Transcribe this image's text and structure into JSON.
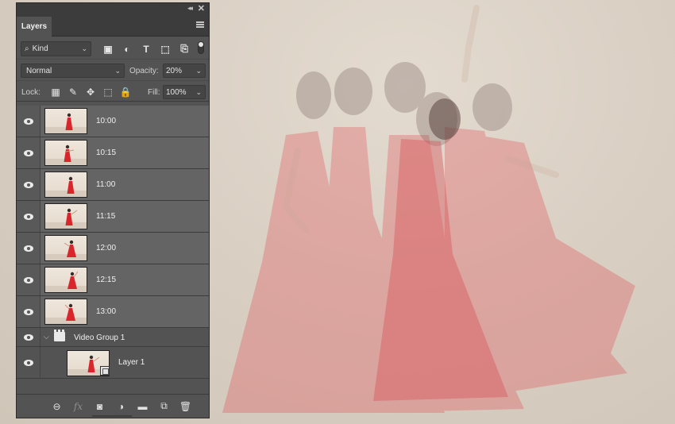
{
  "panel": {
    "collapse_glyph": "◂◂",
    "close_glyph": "✕",
    "tab_label": "Layers",
    "menu_icon": "panel-menu-icon"
  },
  "filter": {
    "kind_label": "Kind",
    "search_glyph": "⌕",
    "chevron": "⌄",
    "icons": [
      {
        "name": "pixel-filter-icon",
        "glyph": "▣"
      },
      {
        "name": "adjustment-filter-icon",
        "glyph": "◐"
      },
      {
        "name": "type-filter-icon",
        "glyph": "T"
      },
      {
        "name": "shape-filter-icon",
        "glyph": "⬚"
      },
      {
        "name": "smart-object-filter-icon",
        "glyph": "⎘"
      }
    ]
  },
  "blend": {
    "mode": "Normal",
    "opacity_label": "Opacity:",
    "opacity_value": "20%",
    "chevron": "⌄"
  },
  "lock": {
    "label": "Lock:",
    "icons": [
      {
        "name": "lock-transparent-icon",
        "glyph": "▦"
      },
      {
        "name": "lock-image-icon",
        "glyph": "✎"
      },
      {
        "name": "lock-position-icon",
        "glyph": "✥"
      },
      {
        "name": "artboard-lock-icon",
        "glyph": "⬚"
      },
      {
        "name": "lock-all-icon",
        "glyph": "🔒"
      }
    ],
    "fill_label": "Fill:",
    "fill_value": "100%"
  },
  "layers": [
    {
      "name": "10:00",
      "pose": 0
    },
    {
      "name": "10:15",
      "pose": 1
    },
    {
      "name": "11:00",
      "pose": 2
    },
    {
      "name": "11:15",
      "pose": 3
    },
    {
      "name": "12:00",
      "pose": 4
    },
    {
      "name": "12:15",
      "pose": 5
    },
    {
      "name": "13:00",
      "pose": 6
    }
  ],
  "group": {
    "disclosure": "⌵",
    "name": "Video Group 1",
    "child": {
      "name": "Layer 1"
    }
  },
  "bottom": {
    "icons": [
      {
        "name": "link-layers-icon",
        "glyph": "⊖"
      },
      {
        "name": "fx-icon",
        "glyph": "fx"
      },
      {
        "name": "add-mask-icon",
        "glyph": "◙"
      },
      {
        "name": "new-adjustment-icon",
        "glyph": "◑"
      },
      {
        "name": "new-group-icon",
        "glyph": "▬"
      },
      {
        "name": "new-layer-icon",
        "glyph": "⧉"
      },
      {
        "name": "delete-layer-icon",
        "glyph": "🗑"
      }
    ]
  },
  "colors": {
    "dress": "#e23a3f",
    "backdrop": "#d9cfc3",
    "panel": "#535353"
  }
}
